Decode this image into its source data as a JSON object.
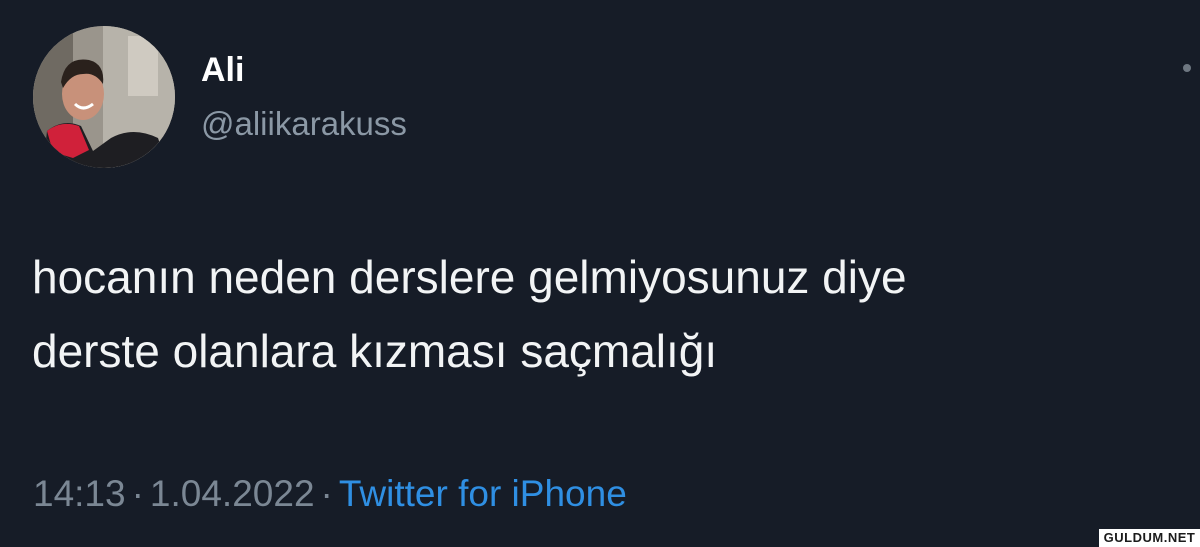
{
  "author": {
    "display_name": "Ali",
    "handle": "@aliikarakuss"
  },
  "tweet": {
    "lines": [
      "hocanın neden derslere gelmiyosunuz diye",
      "derste olanlara kızması saçmalığı"
    ]
  },
  "meta": {
    "time": "14:13",
    "separator": "·",
    "date": "1.04.2022",
    "source": "Twitter for iPhone"
  },
  "watermark": "GULDUM.NET",
  "colors": {
    "background": "#161c27",
    "handle": "#8b98a5",
    "link": "#2f8fe3"
  }
}
